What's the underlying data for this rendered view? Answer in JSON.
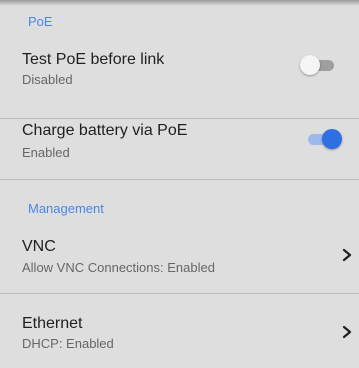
{
  "poe_section": {
    "header": "PoE",
    "items": [
      {
        "title": "Test PoE before link",
        "status": "Disabled",
        "toggle": "off"
      },
      {
        "title": "Charge battery via PoE",
        "status": "Enabled",
        "toggle": "on"
      }
    ]
  },
  "management_section": {
    "header": "Management",
    "items": [
      {
        "title": "VNC",
        "status": "Allow VNC Connections: Enabled",
        "icon": "chevron-right-icon"
      },
      {
        "title": "Ethernet",
        "status": "DHCP: Enabled",
        "icon": "chevron-right-icon"
      }
    ]
  },
  "colors": {
    "background": "#dedede",
    "accent": "#2f6fe4",
    "section_header": "#4a86e8"
  }
}
